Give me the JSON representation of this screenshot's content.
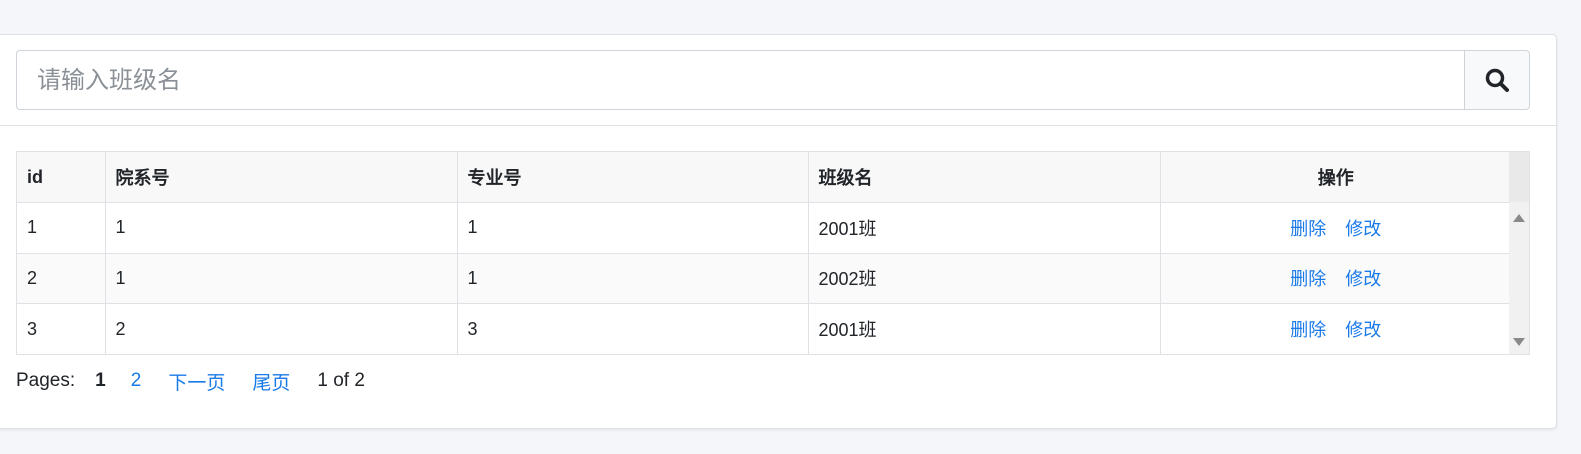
{
  "search": {
    "placeholder": "请输入班级名",
    "icon": "search-icon"
  },
  "table": {
    "columns": [
      "id",
      "院系号",
      "专业号",
      "班级名",
      "操作"
    ],
    "rows": [
      {
        "id": "1",
        "dept": "1",
        "major": "1",
        "class_name": "2001班",
        "delete": "删除",
        "edit": "修改"
      },
      {
        "id": "2",
        "dept": "1",
        "major": "1",
        "class_name": "2002班",
        "delete": "删除",
        "edit": "修改"
      },
      {
        "id": "3",
        "dept": "2",
        "major": "3",
        "class_name": "2001班",
        "delete": "删除",
        "edit": "修改"
      }
    ]
  },
  "pagination": {
    "label": "Pages:",
    "current": "1",
    "page2": "2",
    "next": "下一页",
    "last": "尾页",
    "info": "1 of 2"
  },
  "colors": {
    "link": "#1a7ae8",
    "background": "#f4f6f9"
  }
}
